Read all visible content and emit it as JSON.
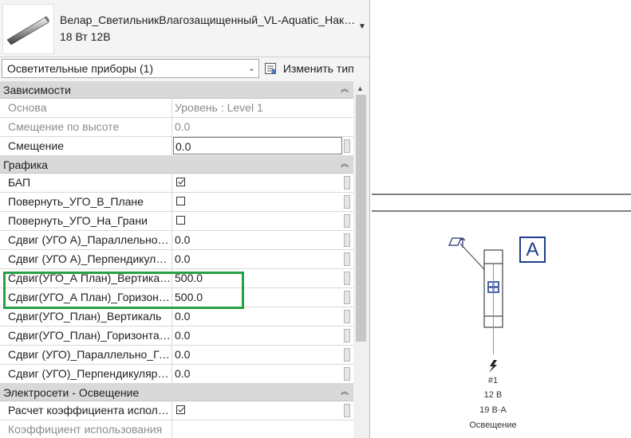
{
  "type_selector": {
    "name": "Велар_СветильникВлагозащищенный_VL-Aquatic_Накладной",
    "subtitle": "18 Вт 12В"
  },
  "filter": {
    "category": "Осветительные приборы (1)",
    "edit_type_label": "Изменить тип"
  },
  "sections": {
    "constraints": "Зависимости",
    "graphics": "Графика",
    "electrical": "Электросети - Освещение"
  },
  "constraints": [
    {
      "name": "Основа",
      "value": "Уровень : Level 1"
    },
    {
      "name": "Смещение по высоте",
      "value": "0.0"
    },
    {
      "name": "Смещение",
      "value": "0.0"
    }
  ],
  "graphics": [
    {
      "name": "БАП",
      "checked": true
    },
    {
      "name": "Повернуть_УГО_В_Плане",
      "checked": false
    },
    {
      "name": "Повернуть_УГО_На_Грани",
      "checked": false
    },
    {
      "name": "Сдвиг (УГО А)_Параллельно_Грани",
      "value": "0.0"
    },
    {
      "name": "Сдвиг (УГО А)_Перпендикулярно_Грани",
      "value": "0.0"
    },
    {
      "name": "Сдвиг(УГО_А План)_Вертикаль",
      "value": "500.0"
    },
    {
      "name": "Сдвиг(УГО_А План)_Горизонталь",
      "value": "500.0"
    },
    {
      "name": "Сдвиг(УГО_План)_Вертикаль",
      "value": "0.0"
    },
    {
      "name": "Сдвиг(УГО_План)_Горизонталь",
      "value": "0.0"
    },
    {
      "name": "Сдвиг (УГО)_Параллельно_Грани",
      "value": "0.0"
    },
    {
      "name": "Сдвиг (УГО)_Перпендикулярно_Грани",
      "value": "0.0"
    }
  ],
  "electrical": [
    {
      "name": "Расчет коэффициента использования",
      "checked": true
    },
    {
      "name": "Коэффициент использования",
      "value": ""
    }
  ],
  "drawing": {
    "label_letter": "A",
    "tag_circuit": "#1",
    "tag_voltage": "12 В",
    "tag_load": "19 В·А",
    "tag_system": "Освещение"
  },
  "colors": {
    "highlight": "#27a046",
    "symbol_blue": "#1e3e8c",
    "wire": "#8a8ae6"
  }
}
